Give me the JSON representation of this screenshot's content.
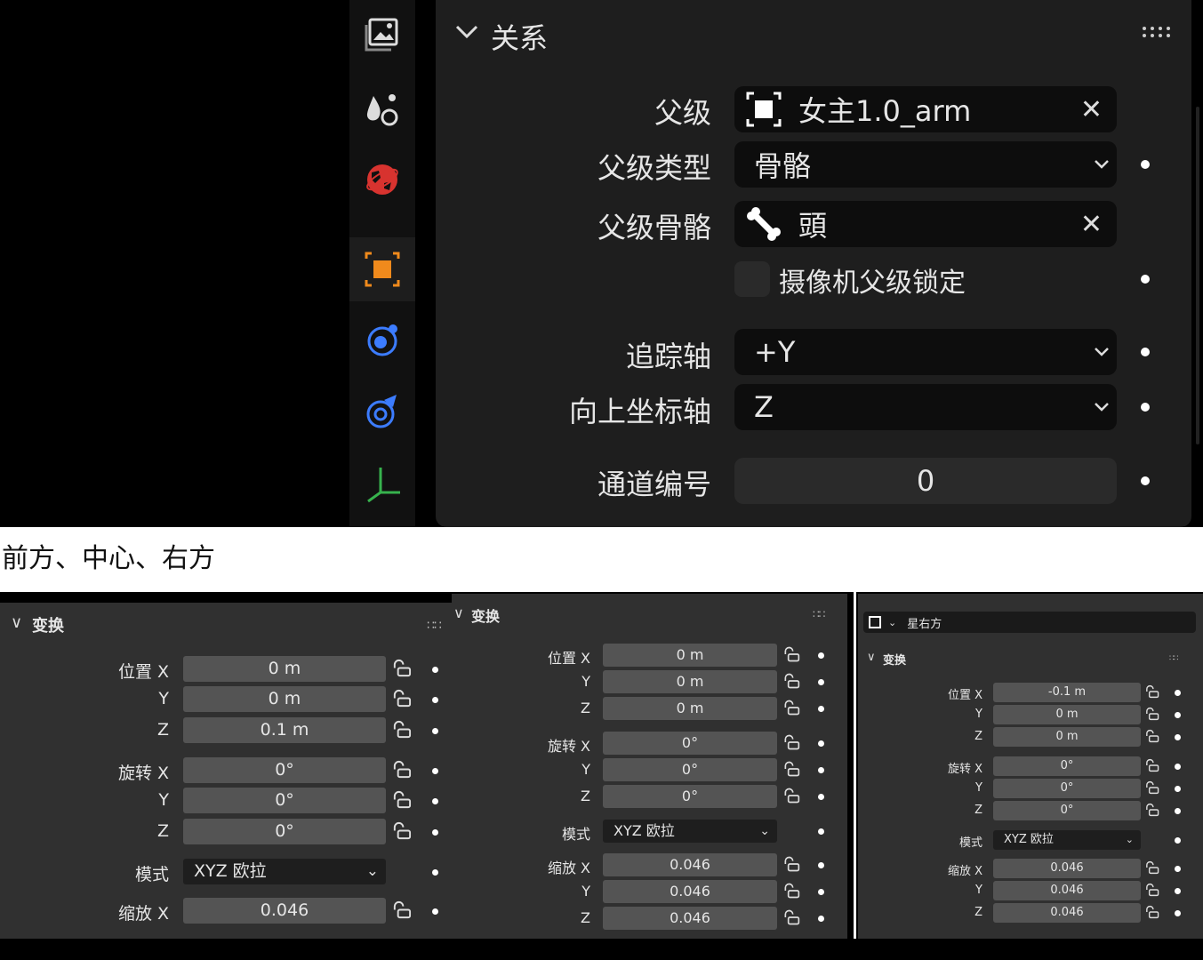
{
  "top": {
    "section_title": "关系",
    "rows": {
      "parent_label": "父级",
      "parent_value": "女主1.0_arm",
      "parent_type_label": "父级类型",
      "parent_type_value": "骨骼",
      "parent_bone_label": "父级骨骼",
      "parent_bone_value": "頭",
      "camera_lock_label": "摄像机父级锁定",
      "track_axis_label": "追踪轴",
      "track_axis_value": "+Y",
      "up_axis_label": "向上坐标轴",
      "up_axis_value": "Z",
      "pass_index_label": "通道编号",
      "pass_index_value": "0"
    }
  },
  "caption": "前方、中心、右方",
  "panels": [
    {
      "title": "变换",
      "rows": [
        {
          "label": "位置 X",
          "value": "0 m"
        },
        {
          "label": "Y",
          "value": "0 m"
        },
        {
          "label": "Z",
          "value": "0.1 m"
        },
        {
          "label": "旋转 X",
          "value": "0°"
        },
        {
          "label": "Y",
          "value": "0°"
        },
        {
          "label": "Z",
          "value": "0°"
        },
        {
          "label": "模式",
          "value": "XYZ 欧拉"
        },
        {
          "label": "缩放 X",
          "value": "0.046"
        }
      ]
    },
    {
      "title": "变换",
      "rows": [
        {
          "label": "位置 X",
          "value": "0 m"
        },
        {
          "label": "Y",
          "value": "0 m"
        },
        {
          "label": "Z",
          "value": "0 m"
        },
        {
          "label": "旋转 X",
          "value": "0°"
        },
        {
          "label": "Y",
          "value": "0°"
        },
        {
          "label": "Z",
          "value": "0°"
        },
        {
          "label": "模式",
          "value": "XYZ 欧拉"
        },
        {
          "label": "缩放 X",
          "value": "0.046"
        },
        {
          "label": "Y",
          "value": "0.046"
        },
        {
          "label": "Z",
          "value": "0.046"
        }
      ]
    },
    {
      "object_name": "星右方",
      "title": "变换",
      "rows": [
        {
          "label": "位置 X",
          "value": "-0.1 m"
        },
        {
          "label": "Y",
          "value": "0 m"
        },
        {
          "label": "Z",
          "value": "0 m"
        },
        {
          "label": "旋转 X",
          "value": "0°"
        },
        {
          "label": "Y",
          "value": "0°"
        },
        {
          "label": "Z",
          "value": "0°"
        },
        {
          "label": "模式",
          "value": "XYZ 欧拉"
        },
        {
          "label": "缩放 X",
          "value": "0.046"
        },
        {
          "label": "Y",
          "value": "0.046"
        },
        {
          "label": "Z",
          "value": "0.046"
        }
      ]
    }
  ],
  "colors": {
    "accent_orange": "#f08a1c",
    "icon_blue": "#3c7cff",
    "icon_red": "#d8332f",
    "axis_green": "#37b24d"
  },
  "icons": [
    "render-image-icon",
    "physics-drops-icon",
    "world-icon",
    "object-icon",
    "constraints-icon",
    "modifier-icon",
    "axis-icon"
  ]
}
